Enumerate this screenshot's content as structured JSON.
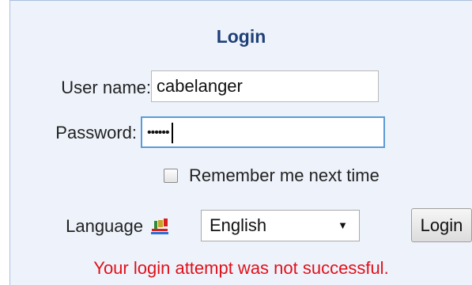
{
  "login": {
    "title": "Login",
    "username_label": "User name:",
    "username_value": "cabelanger",
    "password_label": "Password:",
    "password_mask": "••••••",
    "remember_label": "Remember me next time",
    "remember_checked": false,
    "language_label": "Language",
    "language_selected": "English",
    "language_icon": "language-flag-icon",
    "login_button": "Login",
    "error_message": "Your login attempt was not successful."
  },
  "colors": {
    "panel_bg": "#eef3fb",
    "panel_border": "#a9c0de",
    "title": "#1f3f78",
    "focus_border": "#5b9bd8",
    "error": "#e0101a"
  }
}
